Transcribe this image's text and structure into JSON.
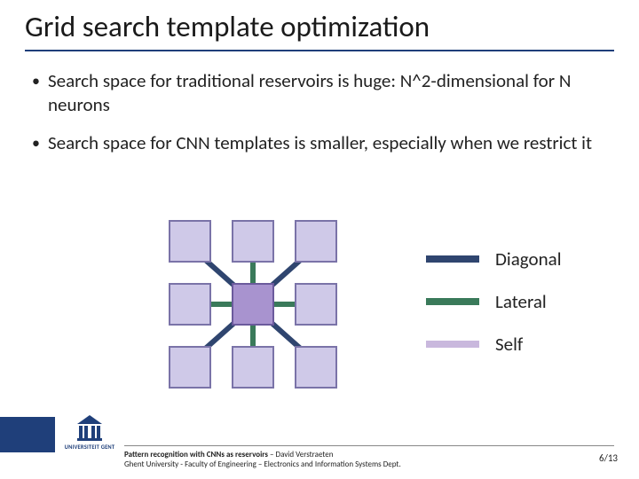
{
  "title": "Grid search template optimization",
  "bullets": [
    "Search space for traditional reservoirs is huge: N^2-dimensional for N neurons",
    "Search space for CNN templates is smaller, especially when we restrict it"
  ],
  "legend": {
    "diagonal": "Diagonal",
    "lateral": "Lateral",
    "self": "Self"
  },
  "colors": {
    "accent": "#1f3f7a",
    "cell_fill": "#cfc9e8",
    "cell_border": "#7a73a8",
    "center_fill": "#a893cf",
    "diag": "#2f456f",
    "lat": "#3a7a5a",
    "self": "#c9b8dd"
  },
  "footer": {
    "line1_bold": "Pattern recognition with CNNs as reservoirs",
    "line1_rest": " – David Verstraeten",
    "line2": "Ghent University - Faculty of Engineering – Electronics and Information Systems Dept.",
    "logo_text": "UNIVERSITEIT GENT"
  },
  "page": "6/13"
}
